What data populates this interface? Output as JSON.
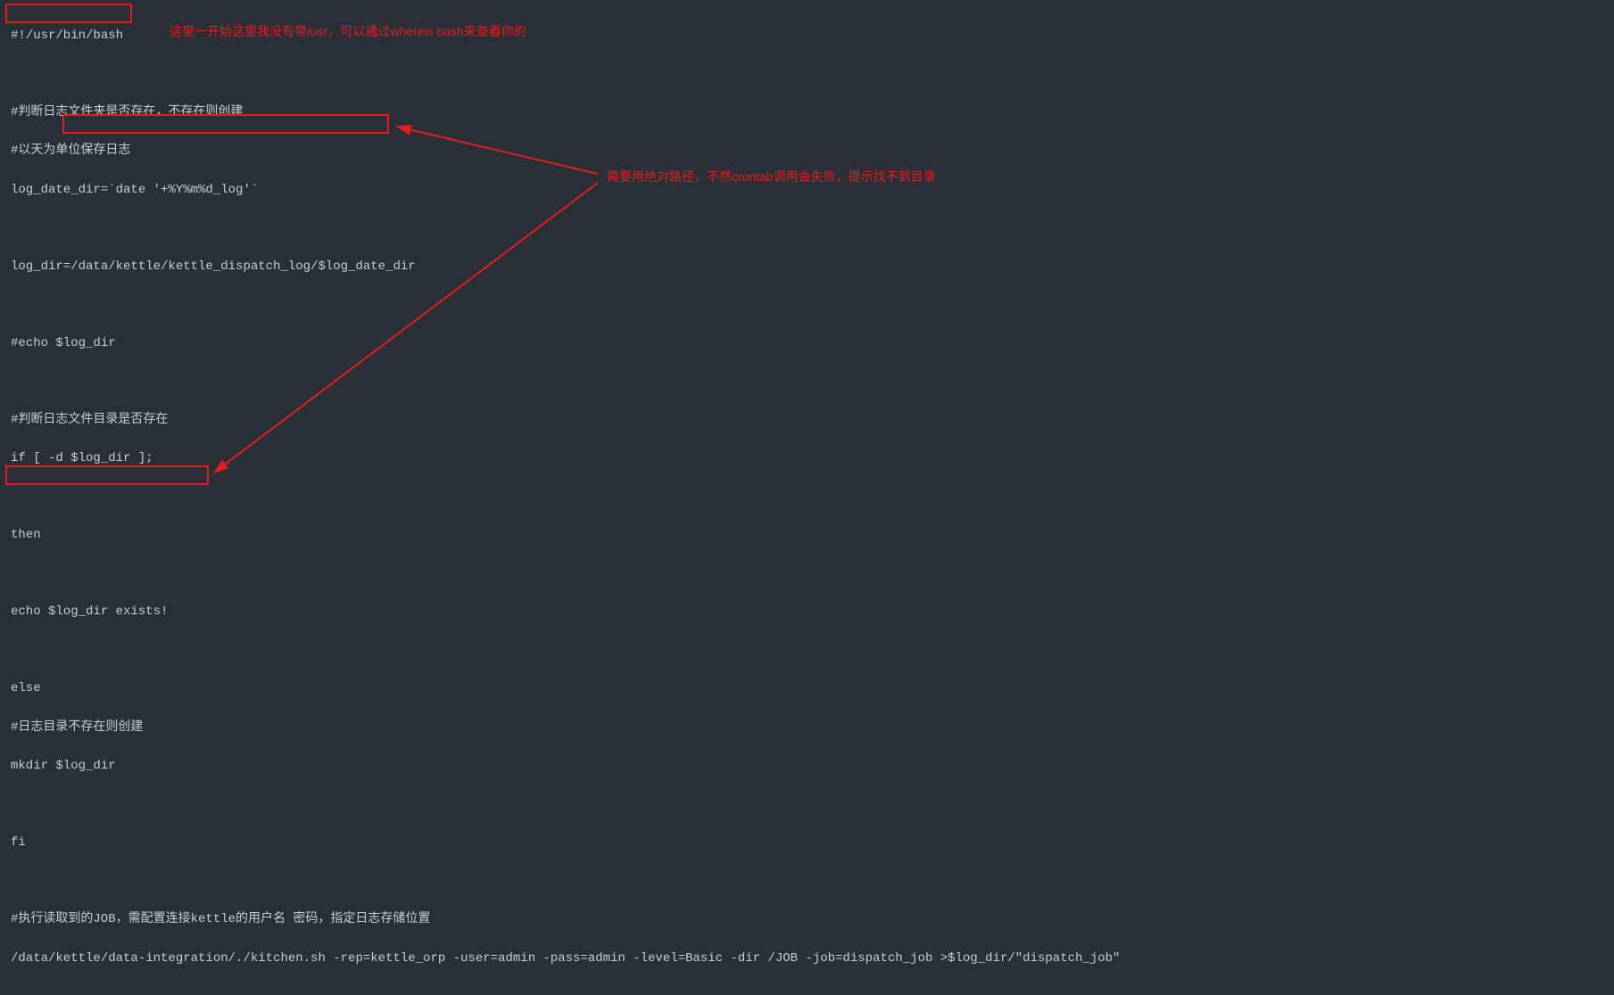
{
  "code": {
    "l1": "#!/usr/bin/bash",
    "l2": "",
    "l3": "#判断日志文件夹是否存在，不存在则创建",
    "l4": "#以天为单位保存日志",
    "l5": "log_date_dir=`date '+%Y%m%d_log'`",
    "l6": "",
    "l7": "log_dir=/data/kettle/kettle_dispatch_log/$log_date_dir",
    "l8": "",
    "l9": "#echo $log_dir",
    "l10": "",
    "l11": "#判断日志文件目录是否存在",
    "l12": "if [ -d $log_dir ];",
    "l13": "",
    "l14": "then",
    "l15": "",
    "l16": "echo $log_dir exists!",
    "l17": "",
    "l18": "else",
    "l19": "#日志目录不存在则创建",
    "l20": "mkdir $log_dir",
    "l21": "",
    "l22": "fi",
    "l23": "",
    "l24": "#执行读取到的JOB，需配置连接kettle的用户名 密码，指定日志存储位置",
    "l25": "/data/kettle/data-integration/./kitchen.sh -rep=kettle_orp -user=admin -pass=admin -level=Basic -dir /JOB -job=dispatch_job >$log_dir/\"dispatch_job\""
  },
  "annotations": {
    "top": "这里一开始这里我没有带/usr，可以通过whereis bash来查看你的",
    "mid": "需要用绝对路径，不然crontab调用会失败，提示找不到目录"
  }
}
